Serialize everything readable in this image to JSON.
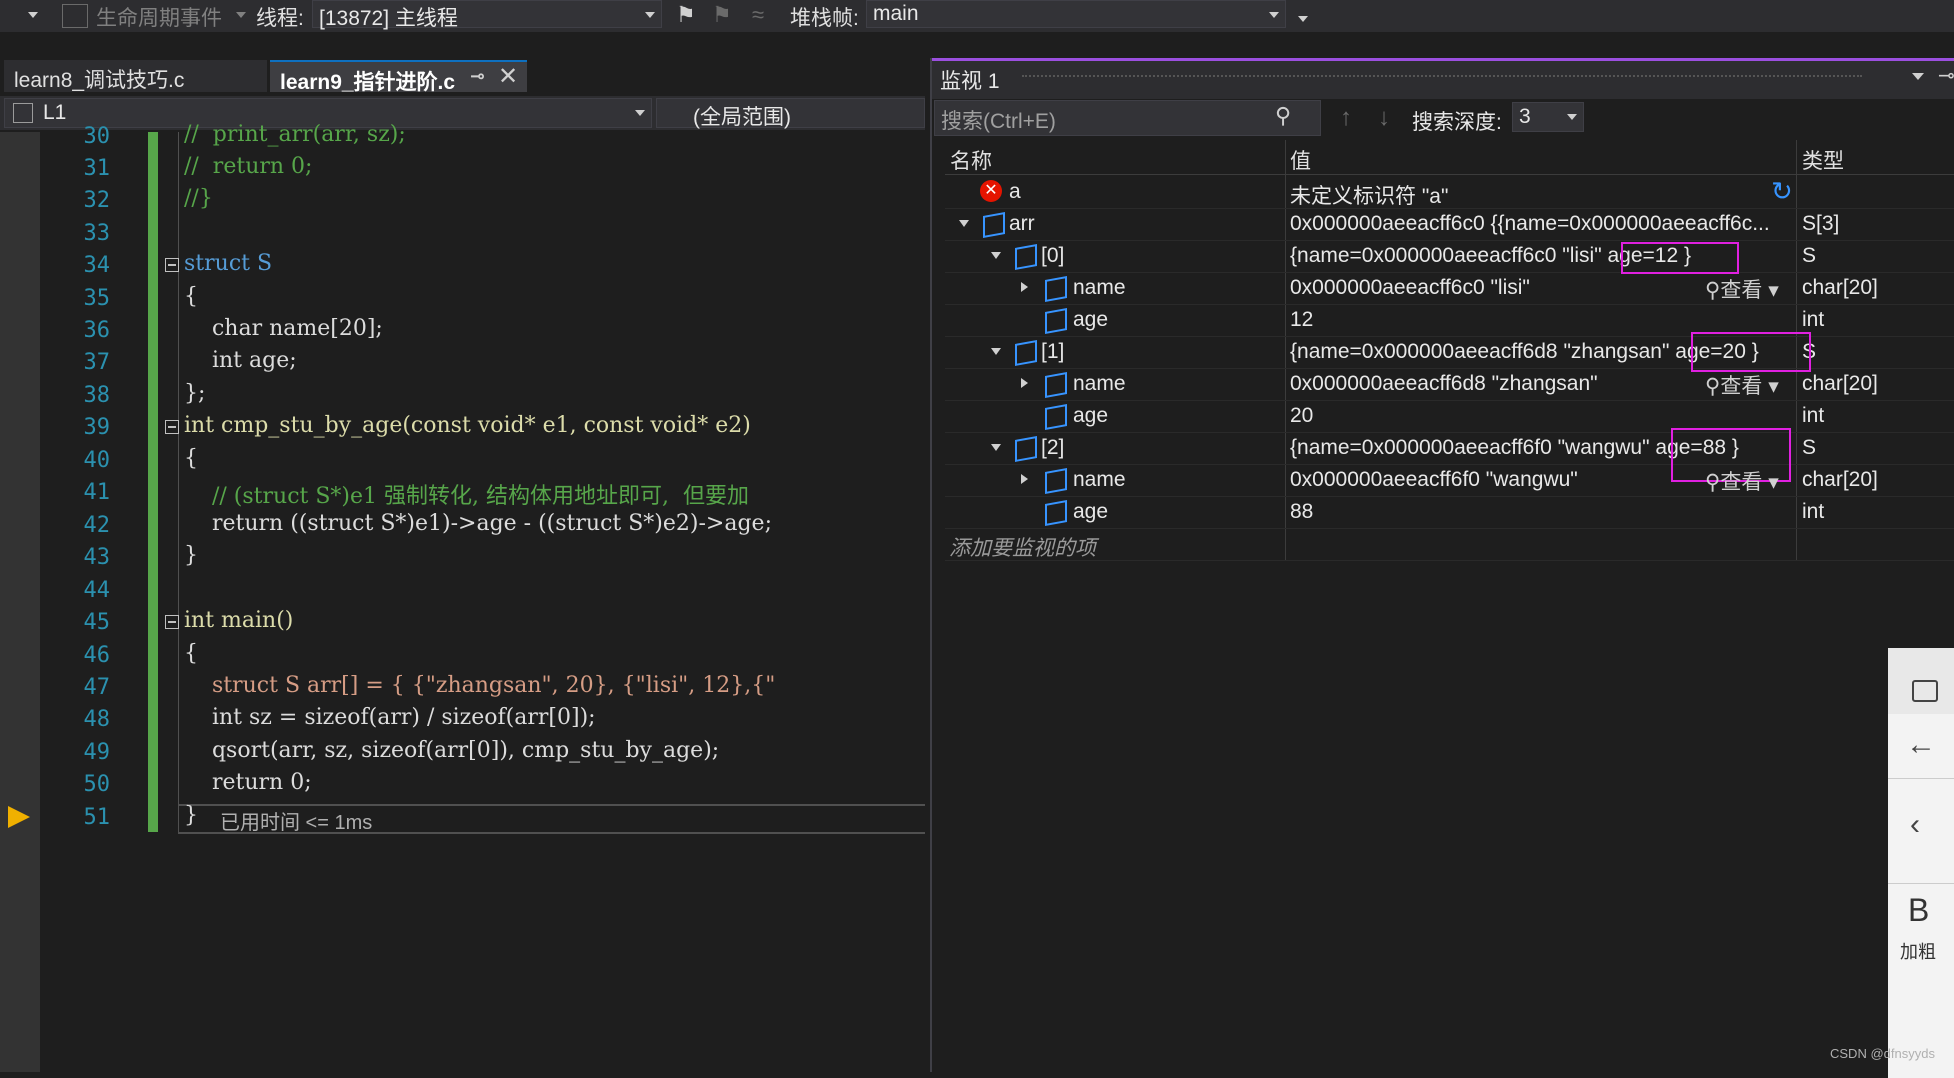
{
  "toolbar": {
    "lifecycle_label": "生命周期事件",
    "thread_label": "线程:",
    "thread_value": "[13872] 主线程",
    "stack_label": "堆栈帧:",
    "stack_value": "main"
  },
  "editor": {
    "tabs": [
      {
        "label": "learn8_调试技巧.c"
      },
      {
        "label": "learn9_指针进阶.c"
      }
    ],
    "nav_left": "L1",
    "nav_right": "(全局范围)",
    "lines": [
      {
        "num": "30",
        "text": "//  print_arr(arr, sz);"
      },
      {
        "num": "31",
        "text": "//  return 0;"
      },
      {
        "num": "32",
        "text": "//}"
      },
      {
        "num": "33",
        "text": ""
      },
      {
        "num": "34",
        "text": "struct S"
      },
      {
        "num": "35",
        "text": "{"
      },
      {
        "num": "36",
        "text": "    char name[20];"
      },
      {
        "num": "37",
        "text": "    int age;"
      },
      {
        "num": "38",
        "text": "};"
      },
      {
        "num": "39",
        "text": "int cmp_stu_by_age(const void* e1, const void* e2)"
      },
      {
        "num": "40",
        "text": "{"
      },
      {
        "num": "41",
        "text": "    // (struct S*)e1 强制转化, 结构体用地址即可,  但要加"
      },
      {
        "num": "42",
        "text": "    return ((struct S*)e1)->age - ((struct S*)e2)->age;"
      },
      {
        "num": "43",
        "text": "}"
      },
      {
        "num": "44",
        "text": ""
      },
      {
        "num": "45",
        "text": "int main()"
      },
      {
        "num": "46",
        "text": "{"
      },
      {
        "num": "47",
        "text": "    struct S arr[] = { {\"zhangsan\", 20}, {\"lisi\", 12},{\""
      },
      {
        "num": "48",
        "text": "    int sz = sizeof(arr) / sizeof(arr[0]);"
      },
      {
        "num": "49",
        "text": "    qsort(arr, sz, sizeof(arr[0]), cmp_stu_by_age);"
      },
      {
        "num": "50",
        "text": "    return 0;"
      },
      {
        "num": "51",
        "text": "}"
      }
    ],
    "elapsed": "已用时间 <= 1ms"
  },
  "watch": {
    "title": "监视 1",
    "search_placeholder": "搜索(Ctrl+E)",
    "depth_label": "搜索深度:",
    "depth_value": "3",
    "columns": {
      "name": "名称",
      "value": "值",
      "type": "类型"
    },
    "view_label": "查看",
    "rows": [
      {
        "name": "a",
        "value": "未定义标识符 \"a\"",
        "type": ""
      },
      {
        "name": "arr",
        "value": "0x000000aeeacff6c0 {{name=0x000000aeeacff6c...",
        "type": "S[3]"
      },
      {
        "name": "[0]",
        "value": "{name=0x000000aeeacff6c0 \"lisi\" age=12 }",
        "type": "S"
      },
      {
        "name": "name",
        "value": "0x000000aeeacff6c0 \"lisi\"",
        "type": "char[20]"
      },
      {
        "name": "age",
        "value": "12",
        "type": "int"
      },
      {
        "name": "[1]",
        "value": "{name=0x000000aeeacff6d8 \"zhangsan\" age=20 }",
        "type": "S"
      },
      {
        "name": "name",
        "value": "0x000000aeeacff6d8 \"zhangsan\"",
        "type": "char[20]"
      },
      {
        "name": "age",
        "value": "20",
        "type": "int"
      },
      {
        "name": "[2]",
        "value": "{name=0x000000aeeacff6f0 \"wangwu\" age=88 }",
        "type": "S"
      },
      {
        "name": "name",
        "value": "0x000000aeeacff6f0 \"wangwu\"",
        "type": "char[20]"
      },
      {
        "name": "age",
        "value": "88",
        "type": "int"
      }
    ],
    "add_item": "添加要监视的项"
  },
  "side": {
    "bold_label": "加粗",
    "bold_glyph": "B"
  },
  "watermark": "CSDN @dfnsyyds",
  "colors": {
    "accent": "#9b4fdf",
    "highlight_box": "#e020e0",
    "change_bar": "#57a64a"
  }
}
